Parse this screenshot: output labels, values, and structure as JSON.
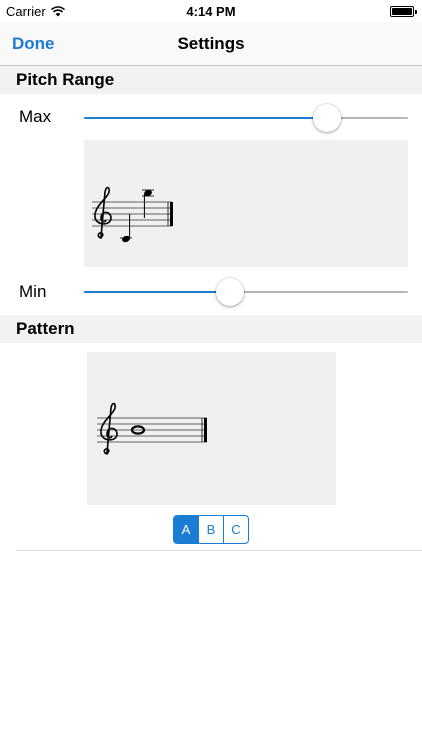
{
  "status_bar": {
    "carrier": "Carrier",
    "time": "4:14 PM"
  },
  "nav": {
    "done_label": "Done",
    "title": "Settings"
  },
  "pitch_range": {
    "header": "Pitch Range",
    "max_label": "Max",
    "max_slider_value": 0.75,
    "min_label": "Min",
    "min_slider_value": 0.45
  },
  "pattern": {
    "header": "Pattern",
    "segments": [
      "A",
      "B",
      "C"
    ],
    "selected_segment": "A"
  },
  "colors": {
    "accent": "#1a7cd3",
    "section_bg": "#f2f2f2",
    "panel_bg": "#f0f0f0"
  },
  "icons": {
    "wifi": "wifi-icon",
    "battery": "battery-icon",
    "clef": "treble-clef-icon"
  }
}
